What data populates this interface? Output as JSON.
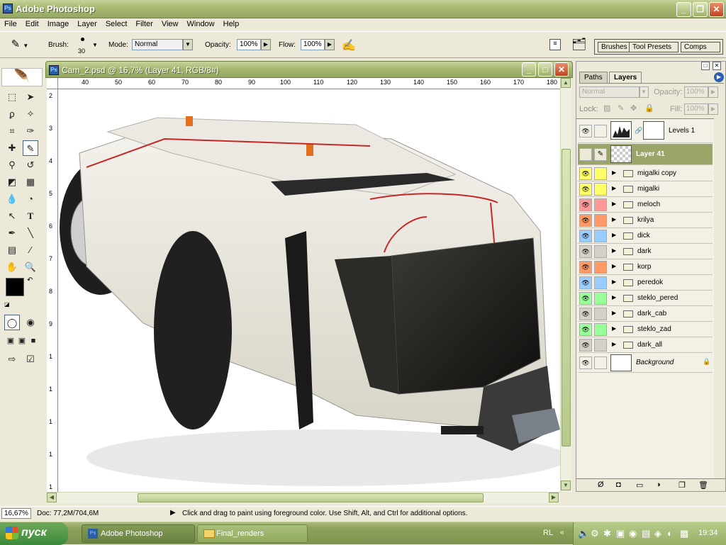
{
  "app": {
    "title": "Adobe Photoshop"
  },
  "menu": [
    "File",
    "Edit",
    "Image",
    "Layer",
    "Select",
    "Filter",
    "View",
    "Window",
    "Help"
  ],
  "options": {
    "brush_label": "Brush:",
    "brush_size": "30",
    "mode_label": "Mode:",
    "mode_value": "Normal",
    "opacity_label": "Opacity:",
    "opacity_value": "100%",
    "flow_label": "Flow:",
    "flow_value": "100%",
    "palette_tabs": [
      "Brushes",
      "Tool Presets",
      "Comps"
    ]
  },
  "document": {
    "title": "Cam_2.psd @ 16,7% (Layer 41, RGB/8#)",
    "ruler_h": [
      "40",
      "50",
      "60",
      "70",
      "80",
      "90",
      "100",
      "110",
      "120",
      "130",
      "140",
      "150",
      "160",
      "170",
      "180"
    ],
    "ruler_v": [
      "2",
      "3",
      "4",
      "5",
      "6",
      "7",
      "8",
      "9",
      "1",
      "1",
      "1",
      "1",
      "1"
    ]
  },
  "layers_panel": {
    "tabs": [
      "Paths",
      "Layers"
    ],
    "blend_mode": "Normal",
    "opacity_label": "Opacity:",
    "opacity_value": "100%",
    "lock_label": "Lock:",
    "fill_label": "Fill:",
    "fill_value": "100%",
    "layers": [
      {
        "name": "Levels 1",
        "color": "#ece9d8",
        "type": "adjustment"
      },
      {
        "name": "Layer 41",
        "color": "#ece9d8",
        "type": "layer",
        "selected": true
      },
      {
        "name": "migalki copy",
        "color": "#ffff66",
        "type": "group"
      },
      {
        "name": "migalki",
        "color": "#ffff66",
        "type": "group"
      },
      {
        "name": "meloch",
        "color": "#ff9999",
        "type": "group"
      },
      {
        "name": "krilya",
        "color": "#ff9966",
        "type": "group"
      },
      {
        "name": "dick",
        "color": "#99ccff",
        "type": "group"
      },
      {
        "name": "dark",
        "color": "#d4d0c8",
        "type": "group"
      },
      {
        "name": "korp",
        "color": "#ff9966",
        "type": "group"
      },
      {
        "name": "peredok",
        "color": "#99ccff",
        "type": "group"
      },
      {
        "name": "steklo_pered",
        "color": "#99ff99",
        "type": "group"
      },
      {
        "name": "dark_cab",
        "color": "#d4d0c8",
        "type": "group"
      },
      {
        "name": "steklo_zad",
        "color": "#99ff99",
        "type": "group"
      },
      {
        "name": "dark_all",
        "color": "#d4d0c8",
        "type": "group"
      },
      {
        "name": "Background",
        "color": "#ece9d8",
        "type": "background"
      }
    ]
  },
  "status": {
    "zoom": "16,67%",
    "doc": "Doc: 77,2M/704,6M",
    "hint": "Click and drag to paint using foreground color.  Use Shift, Alt, and Ctrl for additional options."
  },
  "taskbar": {
    "start": "пуск",
    "items": [
      "Adobe Photoshop",
      "Final_renders"
    ],
    "lang": "RL",
    "clock": "19:34"
  },
  "colors": {
    "xp_olive": "#94a763",
    "selected_layer": "#9aa56a",
    "canvas": "#ffffff"
  }
}
